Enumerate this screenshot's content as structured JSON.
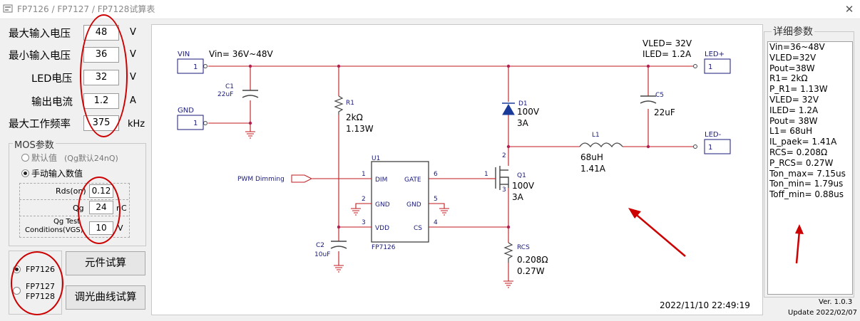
{
  "window": {
    "title": "FP7126 / FP7127 / FP7128试算表",
    "close_icon": "close-icon"
  },
  "params": {
    "max_vin": {
      "label": "最大输入电压",
      "value": "48",
      "unit": "V"
    },
    "min_vin": {
      "label": "最小输入电压",
      "value": "36",
      "unit": "V"
    },
    "led_v": {
      "label": "LED电压",
      "value": "32",
      "unit": "V"
    },
    "out_i": {
      "label": "输出电流",
      "value": "1.2",
      "unit": "A"
    },
    "max_freq": {
      "label": "最大工作频率",
      "value": "375",
      "unit": "kHz"
    }
  },
  "mos": {
    "title": "MOS参数",
    "default_label": "默认值",
    "default_note": "(Qg默认24nQ)",
    "manual_label": "手动输入数值",
    "selected": "manual",
    "rds_label": "Rds(on)",
    "rds_value": "0.12",
    "qg_label": "Qg",
    "qg_value": "24",
    "qg_unit": "nC",
    "vgs_label1": "Qg Test",
    "vgs_label2": "Conditions(VGS)",
    "vgs_value": "10",
    "vgs_unit": "V"
  },
  "chip": {
    "opt1": "FP7126",
    "opt2a": "FP7127",
    "opt2b": "FP7128",
    "selected": "FP7126"
  },
  "buttons": {
    "calc": "元件试算",
    "dimming": "调光曲线试算"
  },
  "schematic": {
    "vin_port": "VIN",
    "vin_text": "Vin= 36V~48V",
    "gnd_port": "GND",
    "port_num": "1",
    "c1_name": "C1",
    "c1_val": "22uF",
    "r1_name": "R1",
    "r1_val": "2kΩ",
    "r1_pow": "1.13W",
    "u1_name": "U1",
    "u1_chip": "FP7126",
    "pin_dim": "DIM",
    "pin_gnd": "GND",
    "pin_vdd": "VDD",
    "pin_gate": "GATE",
    "pin_cs": "CS",
    "pin1": "1",
    "pin2": "2",
    "pin3": "3",
    "pin4": "4",
    "pin5": "5",
    "pin6": "6",
    "pwm": "PWM Dimming",
    "c2_name": "C2",
    "c2_val": "10uF",
    "d1_name": "D1",
    "d1_v": "100V",
    "d1_a": "3A",
    "q1_name": "Q1",
    "q1_v": "100V",
    "q1_a": "3A",
    "q_pin1": "1",
    "q_pin2": "2",
    "q_pin3": "3",
    "l1_name": "L1",
    "l1_val": "68uH",
    "l1_i": "1.41A",
    "c5_name": "C5",
    "c5_val": "22uF",
    "rcs_name": "RCS",
    "rcs_val": "0.208Ω",
    "rcs_pow": "0.27W",
    "vled_text": "VLED= 32V",
    "iled_text": "ILED= 1.2A",
    "ledp_port": "LED+",
    "ledn_port": "LED-",
    "timestamp": "2022/11/10 22:49:19"
  },
  "detail": {
    "title": "详细参数",
    "lines": [
      "Vin=36~48V",
      "VLED=32V",
      "Pout=38W",
      "R1= 2kΩ",
      "P_R1= 1.13W",
      "VLED= 32V",
      "ILED= 1.2A",
      "Pout= 38W",
      "L1= 68uH",
      "IL_paek= 1.41A",
      "RCS= 0.208Ω",
      "P_RCS= 0.27W",
      "Ton_max= 7.15us",
      "Ton_min= 1.79us",
      "Toff_min= 0.88us"
    ]
  },
  "version": {
    "ver": "Ver. 1.0.3",
    "update": "Update 2022/02/07"
  },
  "colors": {
    "annotation": "#cc0000",
    "wire": "#c0181c",
    "component": "#444444",
    "node": "#b02050",
    "port_fill": "#e8f0ff",
    "port_stroke": "#1a1a7a"
  }
}
